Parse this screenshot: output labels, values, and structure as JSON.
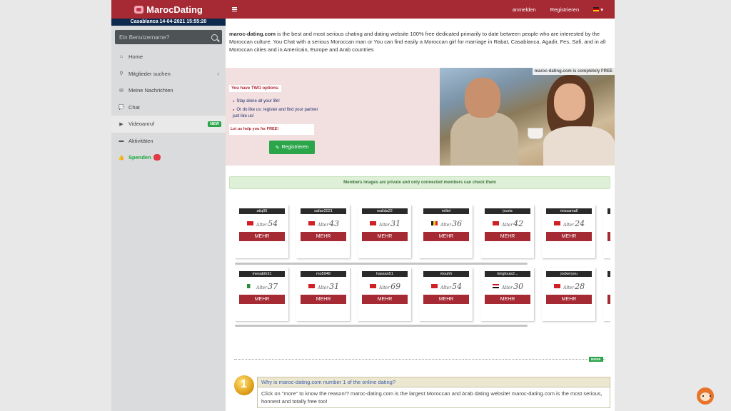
{
  "sidebar": {
    "logo": "MarocDating",
    "datetime": "Casablanca 14-04-2021 15:55:20",
    "search_placeholder": "Ein Benutzername?",
    "nav": [
      {
        "label": "Home",
        "icon": "home-icon",
        "glyph": "⌂"
      },
      {
        "label": "Mitglieder suchen",
        "icon": "search-icon",
        "glyph": "⚲",
        "caret": "‹"
      },
      {
        "label": "Meine Nachrichten",
        "icon": "envelope-icon",
        "glyph": "✉"
      },
      {
        "label": "Chat",
        "icon": "chat-icon",
        "glyph": "💬"
      },
      {
        "label": "Videoanruf",
        "icon": "video-icon",
        "glyph": "▶",
        "badge": "NEW"
      },
      {
        "label": "Aktivitäten",
        "icon": "folder-icon",
        "glyph": "▬"
      },
      {
        "label": "Spenden",
        "icon": "thumbs-up-icon",
        "glyph": "👍"
      }
    ]
  },
  "topbar": {
    "login": "anmelden",
    "register": "Registrieren",
    "language_caret": "▾"
  },
  "intro": {
    "site": "maroc-dating.com",
    "text": " is the best and most serious chating and dating website 100% free dedicated primarily to date between people who are interested by the Moroccan culture. You Chat with a serious Moroccan man or You can find easily a Moroccan girl for marriage in Rabat, Casablanca, Agadir, Fes, Safi, and in all Moroccan cities and in Americain, Europe and Arab countries"
  },
  "promo": {
    "free_badge": "maroc-dating.com is completely FREE",
    "options_title": "You have TWO options:",
    "options": [
      "Stay alone all your life!",
      "Or do like us: register and find your partner just like us!"
    ],
    "help_free": "Let us help you for FREE!",
    "register_button": "Registrieren"
  },
  "private_notice": "Members images are private and only connected members can check them",
  "members": {
    "age_label": "Alter",
    "button_label": "MEHR",
    "row1": [
      {
        "username": "atiq95",
        "age": "54",
        "flag": "morocco"
      },
      {
        "username": "safae2021",
        "age": "43",
        "flag": "morocco"
      },
      {
        "username": "walida22",
        "age": "31",
        "flag": "morocco"
      },
      {
        "username": "miliel",
        "age": "36",
        "flag": "belgium"
      },
      {
        "username": "jouria",
        "age": "42",
        "flag": "morocco"
      },
      {
        "username": "missamall",
        "age": "24",
        "flag": "morocco"
      }
    ],
    "row2": [
      {
        "username": "mesabih31",
        "age": "37",
        "flag": "algeria"
      },
      {
        "username": "mo5948",
        "age": "31",
        "flag": "morocco"
      },
      {
        "username": "hassan51",
        "age": "69",
        "flag": "morocco"
      },
      {
        "username": "mouhh",
        "age": "54",
        "flag": "morocco"
      },
      {
        "username": "kinglouis2...",
        "age": "30",
        "flag": "egypt"
      },
      {
        "username": "jockeryou",
        "age": "28",
        "flag": "morocco"
      }
    ]
  },
  "more_button": "MORE",
  "faq": {
    "title": "Why is maroc-dating.com number 1 of the online dating?",
    "body": "Click on \"more\" to know the reason!? maroc-dating.com is the largest Moroccan and Arab dating website! maroc-dating.com is the most serious, honnest and totally free too!"
  },
  "colors": {
    "brand": "#a52a34",
    "sidebar": "#dadbdc",
    "accent_green": "#2aa54a",
    "datetime_bar": "#0d2a4e"
  },
  "flags": {
    "morocco": "#d11f26",
    "belgium": "linear-gradient(90deg,#222 0 33%,#f7d117 33% 66%,#e3222a 66%)",
    "algeria": "linear-gradient(90deg,#2e8b3a 0 50%,#fff 50%)",
    "egypt": "linear-gradient(#ce1126 0 33%,#fff 33% 66%,#111 66%)"
  }
}
